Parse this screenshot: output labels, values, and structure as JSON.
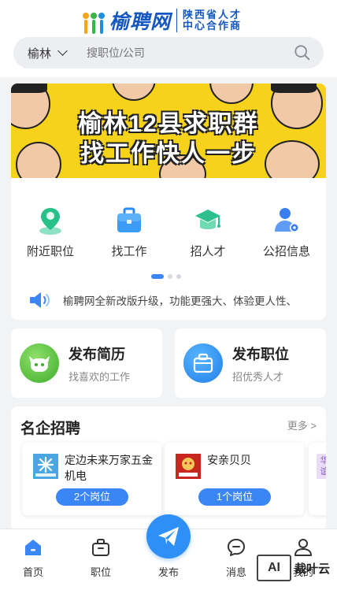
{
  "header": {
    "logo_name": "榆聘网",
    "logo_sub_line1": "陕西省人才",
    "logo_sub_line2": "中心合作商"
  },
  "search": {
    "city": "榆林",
    "placeholder": "搜职位/公司"
  },
  "banner": {
    "line1": "榆林12县求职群",
    "line2": "找工作快人一步"
  },
  "quick_links": [
    {
      "label": "附近职位",
      "icon": "location-pin-icon"
    },
    {
      "label": "找工作",
      "icon": "briefcase-icon"
    },
    {
      "label": "招人才",
      "icon": "graduation-cap-icon"
    },
    {
      "label": "公招信息",
      "icon": "user-badge-icon"
    }
  ],
  "carousel": {
    "pages": 3,
    "active": 1
  },
  "notice": {
    "text": "榆聘网全新改版升级，功能更强大、体验更人性、"
  },
  "publish": {
    "resume": {
      "title": "发布简历",
      "subtitle": "找喜欢的工作"
    },
    "job": {
      "title": "发布职位",
      "subtitle": "招优秀人才"
    }
  },
  "corp_section": {
    "title": "名企招聘",
    "more": "更多 >",
    "companies": [
      {
        "name": "定边未来万家五金机电",
        "positions": "2个岗位"
      },
      {
        "name": "安亲贝贝",
        "positions": "1个岗位"
      }
    ],
    "partial_logo_text": "华谊"
  },
  "tabbar": {
    "items": [
      {
        "label": "首页"
      },
      {
        "label": "职位"
      },
      {
        "label": "发布"
      },
      {
        "label": "消息"
      },
      {
        "label": "我的"
      }
    ]
  },
  "watermark": {
    "badge": "AI",
    "text": "裁叶云"
  },
  "colors": {
    "brand_blue": "#1557c0",
    "accent_blue": "#3a86f4",
    "banner_yellow": "#f6d21a",
    "resume_green": "#58c43c",
    "job_blue": "#2d8df0"
  }
}
